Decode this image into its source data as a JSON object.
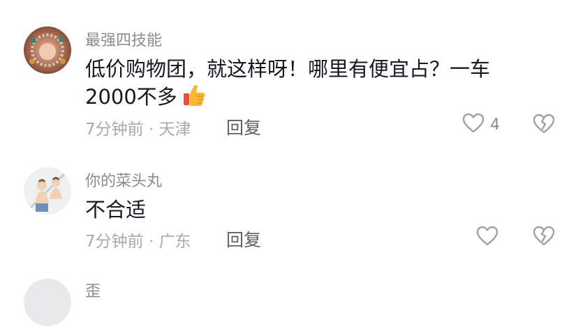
{
  "comments": [
    {
      "username": "最强四技能",
      "text": "低价购物团，就这样呀！哪里有便宜占？一车2000不多",
      "emoji_icon": "thumbs-up-icon",
      "time": "7分钟前",
      "separator": " · ",
      "location": "天津",
      "reply_label": "回复",
      "likes": "4"
    },
    {
      "username": "你的菜头丸",
      "text": "不合适",
      "time": "7分钟前",
      "separator": " · ",
      "location": "广东",
      "reply_label": "回复",
      "likes": ""
    },
    {
      "username": "歪"
    }
  ],
  "icons": {
    "like": "heart-outline-icon",
    "dislike": "broken-heart-outline-icon"
  },
  "colors": {
    "text_primary": "#161823",
    "text_secondary": "#8a8b91",
    "icon_stroke": "#a0a1a7"
  }
}
